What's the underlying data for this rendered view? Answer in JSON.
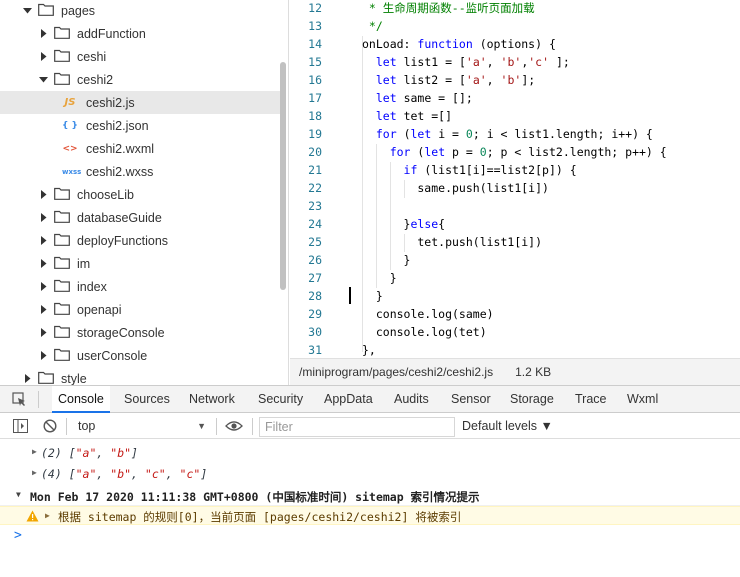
{
  "file_tree": {
    "items": [
      {
        "label": "pages",
        "type": "folder",
        "expanded": true,
        "depth": 0
      },
      {
        "label": "addFunction",
        "type": "folder",
        "expanded": false,
        "depth": 1
      },
      {
        "label": "ceshi",
        "type": "folder",
        "expanded": false,
        "depth": 1
      },
      {
        "label": "ceshi2",
        "type": "folder",
        "expanded": true,
        "depth": 1
      },
      {
        "label": "ceshi2.js",
        "type": "js",
        "depth": 2,
        "selected": true
      },
      {
        "label": "ceshi2.json",
        "type": "json",
        "depth": 2
      },
      {
        "label": "ceshi2.wxml",
        "type": "wxml",
        "depth": 2
      },
      {
        "label": "ceshi2.wxss",
        "type": "wxss",
        "depth": 2
      },
      {
        "label": "chooseLib",
        "type": "folder",
        "expanded": false,
        "depth": 1
      },
      {
        "label": "databaseGuide",
        "type": "folder",
        "expanded": false,
        "depth": 1
      },
      {
        "label": "deployFunctions",
        "type": "folder",
        "expanded": false,
        "depth": 1
      },
      {
        "label": "im",
        "type": "folder",
        "expanded": false,
        "depth": 1
      },
      {
        "label": "index",
        "type": "folder",
        "expanded": false,
        "depth": 1
      },
      {
        "label": "openapi",
        "type": "folder",
        "expanded": false,
        "depth": 1
      },
      {
        "label": "storageConsole",
        "type": "folder",
        "expanded": false,
        "depth": 1
      },
      {
        "label": "userConsole",
        "type": "folder",
        "expanded": false,
        "depth": 1
      },
      {
        "label": "style",
        "type": "folder",
        "expanded": false,
        "depth": 0
      }
    ],
    "icon_glyphs": {
      "js": "JS",
      "json": "{ }",
      "wxml": "<>",
      "wxss": "wxss"
    },
    "icon_colors": {
      "js": "#e8a33d",
      "json": "#3c8ce7",
      "wxml": "#e2553a",
      "wxss": "#3c8ce7"
    }
  },
  "editor": {
    "lines": [
      {
        "num": "12",
        "tokens": [
          [
            "cmt",
            " * 生命周期函数--监听页面加载"
          ]
        ]
      },
      {
        "num": "13",
        "tokens": [
          [
            "cmt",
            " */"
          ]
        ]
      },
      {
        "num": "14",
        "tokens": [
          [
            "plain",
            "onLoad: "
          ],
          [
            "kw",
            "function"
          ],
          [
            "plain",
            " (options) {"
          ]
        ]
      },
      {
        "num": "15",
        "tokens": [
          [
            "plain",
            "  "
          ],
          [
            "kw",
            "let"
          ],
          [
            "plain",
            " list1 = ["
          ],
          [
            "str",
            "'a'"
          ],
          [
            "plain",
            ", "
          ],
          [
            "str",
            "'b'"
          ],
          [
            "plain",
            ","
          ],
          [
            "str",
            "'c'"
          ],
          [
            "plain",
            " ];"
          ]
        ]
      },
      {
        "num": "16",
        "tokens": [
          [
            "plain",
            "  "
          ],
          [
            "kw",
            "let"
          ],
          [
            "plain",
            " list2 = ["
          ],
          [
            "str",
            "'a'"
          ],
          [
            "plain",
            ", "
          ],
          [
            "str",
            "'b'"
          ],
          [
            "plain",
            "];"
          ]
        ]
      },
      {
        "num": "17",
        "tokens": [
          [
            "plain",
            "  "
          ],
          [
            "kw",
            "let"
          ],
          [
            "plain",
            " same = [];"
          ]
        ]
      },
      {
        "num": "18",
        "tokens": [
          [
            "plain",
            "  "
          ],
          [
            "kw",
            "let"
          ],
          [
            "plain",
            " tet =[]"
          ]
        ]
      },
      {
        "num": "19",
        "tokens": [
          [
            "plain",
            "  "
          ],
          [
            "kw",
            "for"
          ],
          [
            "plain",
            " ("
          ],
          [
            "kw",
            "let"
          ],
          [
            "plain",
            " i = "
          ],
          [
            "num",
            "0"
          ],
          [
            "plain",
            "; i < list1.length; i++) {"
          ]
        ]
      },
      {
        "num": "20",
        "tokens": [
          [
            "plain",
            "    "
          ],
          [
            "kw",
            "for"
          ],
          [
            "plain",
            " ("
          ],
          [
            "kw",
            "let"
          ],
          [
            "plain",
            " p = "
          ],
          [
            "num",
            "0"
          ],
          [
            "plain",
            "; p < list2.length; p++) {"
          ]
        ]
      },
      {
        "num": "21",
        "tokens": [
          [
            "plain",
            "      "
          ],
          [
            "kw",
            "if"
          ],
          [
            "plain",
            " (list1[i]==list2[p]) {"
          ]
        ]
      },
      {
        "num": "22",
        "tokens": [
          [
            "plain",
            "        same.push(list1[i])"
          ]
        ]
      },
      {
        "num": "23",
        "tokens": [
          [
            "plain",
            ""
          ]
        ]
      },
      {
        "num": "24",
        "tokens": [
          [
            "plain",
            "      }"
          ],
          [
            "kw",
            "else"
          ],
          [
            "plain",
            "{"
          ]
        ]
      },
      {
        "num": "25",
        "tokens": [
          [
            "plain",
            "        tet.push(list1[i])"
          ]
        ]
      },
      {
        "num": "26",
        "tokens": [
          [
            "plain",
            "      }"
          ]
        ]
      },
      {
        "num": "27",
        "tokens": [
          [
            "plain",
            "    }"
          ]
        ]
      },
      {
        "num": "28",
        "tokens": [
          [
            "plain",
            "  }"
          ]
        ]
      },
      {
        "num": "29",
        "tokens": [
          [
            "plain",
            "  console.log(same)"
          ]
        ]
      },
      {
        "num": "30",
        "tokens": [
          [
            "plain",
            "  console.log(tet)"
          ]
        ]
      },
      {
        "num": "31",
        "tokens": [
          [
            "plain",
            "},"
          ]
        ]
      }
    ]
  },
  "status": {
    "path": "/miniprogram/pages/ceshi2/ceshi2.js",
    "size": "1.2 KB"
  },
  "devtools": {
    "tabs": [
      "Console",
      "Sources",
      "Network",
      "Security",
      "AppData",
      "Audits",
      "Sensor",
      "Storage",
      "Trace",
      "Wxml"
    ],
    "active_tab": "Console",
    "context": "top",
    "filter_placeholder": "Filter",
    "levels": "Default levels ▼"
  },
  "console": {
    "entries": [
      {
        "prefix": "(2) [",
        "items": [
          "\"a\"",
          "\"b\""
        ],
        "suffix": "]"
      },
      {
        "prefix": "(4) [",
        "items": [
          "\"a\"",
          "\"b\"",
          "\"c\"",
          "\"c\""
        ],
        "suffix": "]"
      }
    ],
    "group": "Mon Feb 17 2020 11:11:38 GMT+0800 (中国标准时间) sitemap 索引情况提示",
    "warning": "根据 sitemap 的规则[0]，当前页面 [pages/ceshi2/ceshi2] 将被索引",
    "prompt": ">"
  },
  "colors": {
    "accent": "#1a73e8",
    "selected_row": "#e8e8e8",
    "warning_bg": "#fffbe5"
  }
}
